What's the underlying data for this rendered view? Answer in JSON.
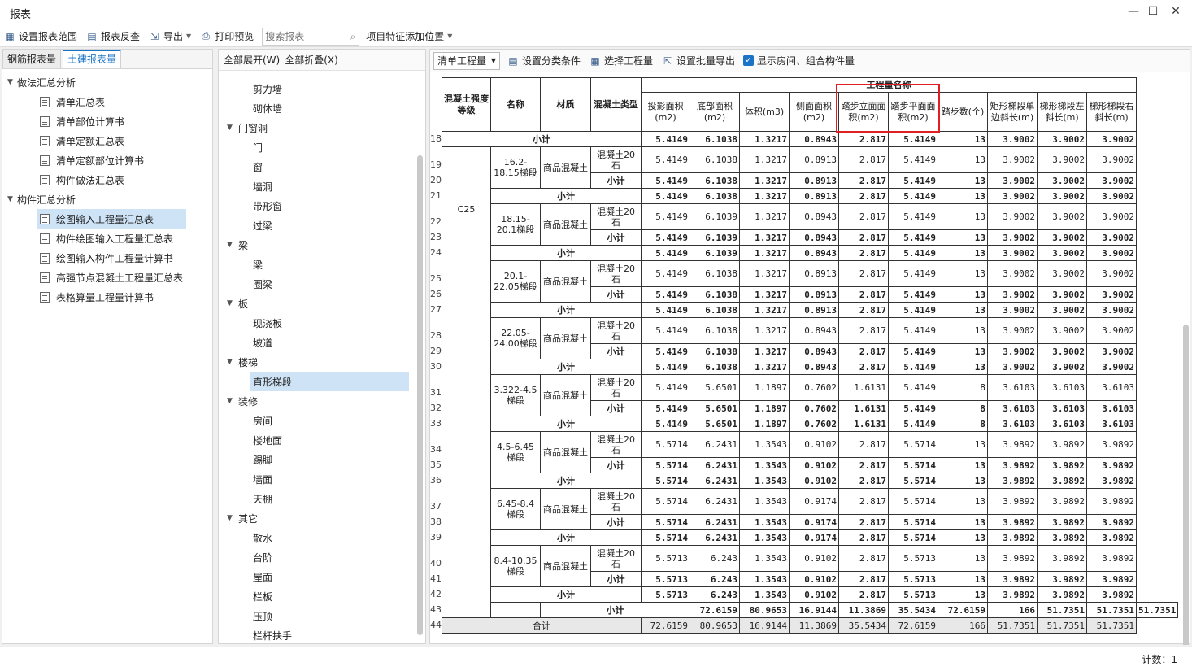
{
  "window": {
    "title": "报表"
  },
  "toolbar": {
    "set_range": "设置报表范围",
    "reverse": "报表反查",
    "export": "导出",
    "print_preview": "打印预览",
    "search_placeholder": "搜索报表",
    "add_position": "项目特征添加位置"
  },
  "left": {
    "tabs": [
      "钢筋报表量",
      "土建报表量"
    ],
    "active_tab": 1,
    "groups": [
      {
        "label": "做法汇总分析",
        "items": [
          "清单汇总表",
          "清单部位计算书",
          "清单定额汇总表",
          "清单定额部位计算书",
          "构件做法汇总表"
        ]
      },
      {
        "label": "构件汇总分析",
        "items": [
          "绘图输入工程量汇总表",
          "构件绘图输入工程量汇总表",
          "绘图输入构件工程量计算书",
          "高强节点混凝土工程量汇总表",
          "表格算量工程量计算书"
        ]
      }
    ],
    "selected": "绘图输入工程量汇总表"
  },
  "middle": {
    "expand_all": "全部展开(W)",
    "collapse_all": "全部折叠(X)",
    "nodes": [
      {
        "t": "剪力墙",
        "l": 1
      },
      {
        "t": "砌体墙",
        "l": 1
      },
      {
        "t": "门窗洞",
        "l": 0
      },
      {
        "t": "门",
        "l": 1
      },
      {
        "t": "窗",
        "l": 1
      },
      {
        "t": "墙洞",
        "l": 1
      },
      {
        "t": "带形窗",
        "l": 1
      },
      {
        "t": "过梁",
        "l": 1
      },
      {
        "t": "梁",
        "l": 0
      },
      {
        "t": "梁",
        "l": 1
      },
      {
        "t": "圈梁",
        "l": 1
      },
      {
        "t": "板",
        "l": 0
      },
      {
        "t": "现浇板",
        "l": 1
      },
      {
        "t": "坡道",
        "l": 1
      },
      {
        "t": "楼梯",
        "l": 0
      },
      {
        "t": "直形梯段",
        "l": 1
      },
      {
        "t": "装修",
        "l": 0
      },
      {
        "t": "房间",
        "l": 1
      },
      {
        "t": "楼地面",
        "l": 1
      },
      {
        "t": "踢脚",
        "l": 1
      },
      {
        "t": "墙面",
        "l": 1
      },
      {
        "t": "天棚",
        "l": 1
      },
      {
        "t": "其它",
        "l": 0
      },
      {
        "t": "散水",
        "l": 1
      },
      {
        "t": "台阶",
        "l": 1
      },
      {
        "t": "屋面",
        "l": 1
      },
      {
        "t": "栏板",
        "l": 1
      },
      {
        "t": "压顶",
        "l": 1
      },
      {
        "t": "栏杆扶手",
        "l": 1
      }
    ],
    "selected": "直形梯段"
  },
  "right": {
    "combo": "清单工程量",
    "set_category": "设置分类条件",
    "select_project": "选择工程量",
    "batch_export": "设置批量导出",
    "show_rooms": "显示房间、组合构件量",
    "show_rooms_checked": true
  },
  "grid": {
    "headers": {
      "grade": "混凝土强度等级",
      "name": "名称",
      "material": "材质",
      "type": "混凝土类型",
      "group": "工程量名称",
      "cols": [
        "投影面积(m2)",
        "底部面积(m2)",
        "体积(m3)",
        "侧面面积(m2)",
        "踏步立面面积(m2)",
        "踏步平面面积(m2)",
        "踏步数(个)",
        "矩形梯段单边斜长(m)",
        "梯形梯段左斜长(m)",
        "梯形梯段右斜长(m)"
      ]
    },
    "grade": "C25",
    "material": "商品混凝土",
    "type": "混凝土20石",
    "subtotal": "小计",
    "total": "合计",
    "first_subtotal": {
      "row": "18",
      "vals": [
        "5.4149",
        "6.1038",
        "1.3217",
        "0.8943",
        "2.817",
        "5.4149",
        "13",
        "3.9002",
        "3.9002",
        "3.9002"
      ]
    },
    "groups": [
      {
        "name": "16.2-18.15梯段",
        "rows": [
          "19",
          "20",
          "21"
        ],
        "vals": [
          "5.4149",
          "6.1038",
          "1.3217",
          "0.8913",
          "2.817",
          "5.4149",
          "13",
          "3.9002",
          "3.9002",
          "3.9002"
        ]
      },
      {
        "name": "18.15-20.1梯段",
        "rows": [
          "22",
          "23",
          "24"
        ],
        "vals": [
          "5.4149",
          "6.1039",
          "1.3217",
          "0.8943",
          "2.817",
          "5.4149",
          "13",
          "3.9002",
          "3.9002",
          "3.9002"
        ]
      },
      {
        "name": "20.1-22.05梯段",
        "rows": [
          "25",
          "26",
          "27"
        ],
        "vals": [
          "5.4149",
          "6.1038",
          "1.3217",
          "0.8913",
          "2.817",
          "5.4149",
          "13",
          "3.9002",
          "3.9002",
          "3.9002"
        ]
      },
      {
        "name": "22.05-24.00梯段",
        "rows": [
          "28",
          "29",
          "30"
        ],
        "vals": [
          "5.4149",
          "6.1038",
          "1.3217",
          "0.8943",
          "2.817",
          "5.4149",
          "13",
          "3.9002",
          "3.9002",
          "3.9002"
        ]
      },
      {
        "name": "3.322-4.5梯段",
        "rows": [
          "31",
          "32",
          "33"
        ],
        "vals": [
          "5.4149",
          "5.6501",
          "1.1897",
          "0.7602",
          "1.6131",
          "5.4149",
          "8",
          "3.6103",
          "3.6103",
          "3.6103"
        ]
      },
      {
        "name": "4.5-6.45梯段",
        "rows": [
          "34",
          "35",
          "36"
        ],
        "vals": [
          "5.5714",
          "6.2431",
          "1.3543",
          "0.9102",
          "2.817",
          "5.5714",
          "13",
          "3.9892",
          "3.9892",
          "3.9892"
        ]
      },
      {
        "name": "6.45-8.4梯段",
        "rows": [
          "37",
          "38",
          "39"
        ],
        "vals": [
          "5.5714",
          "6.2431",
          "1.3543",
          "0.9174",
          "2.817",
          "5.5714",
          "13",
          "3.9892",
          "3.9892",
          "3.9892"
        ]
      },
      {
        "name": "8.4-10.35梯段",
        "rows": [
          "40",
          "41",
          "42"
        ],
        "vals": [
          "5.5713",
          "6.243",
          "1.3543",
          "0.9102",
          "2.817",
          "5.5713",
          "13",
          "3.9892",
          "3.9892",
          "3.9892"
        ]
      }
    ],
    "grand_subtotal": {
      "row": "43",
      "vals": [
        "72.6159",
        "80.9653",
        "16.9144",
        "11.3869",
        "35.5434",
        "72.6159",
        "166",
        "51.7351",
        "51.7351",
        "51.7351"
      ]
    },
    "total_row": {
      "row": "44",
      "vals": [
        "72.6159",
        "80.9653",
        "16.9144",
        "11.3869",
        "35.5434",
        "72.6159",
        "166",
        "51.7351",
        "51.7351",
        "51.7351"
      ]
    }
  },
  "status": {
    "count": "计数：1"
  }
}
